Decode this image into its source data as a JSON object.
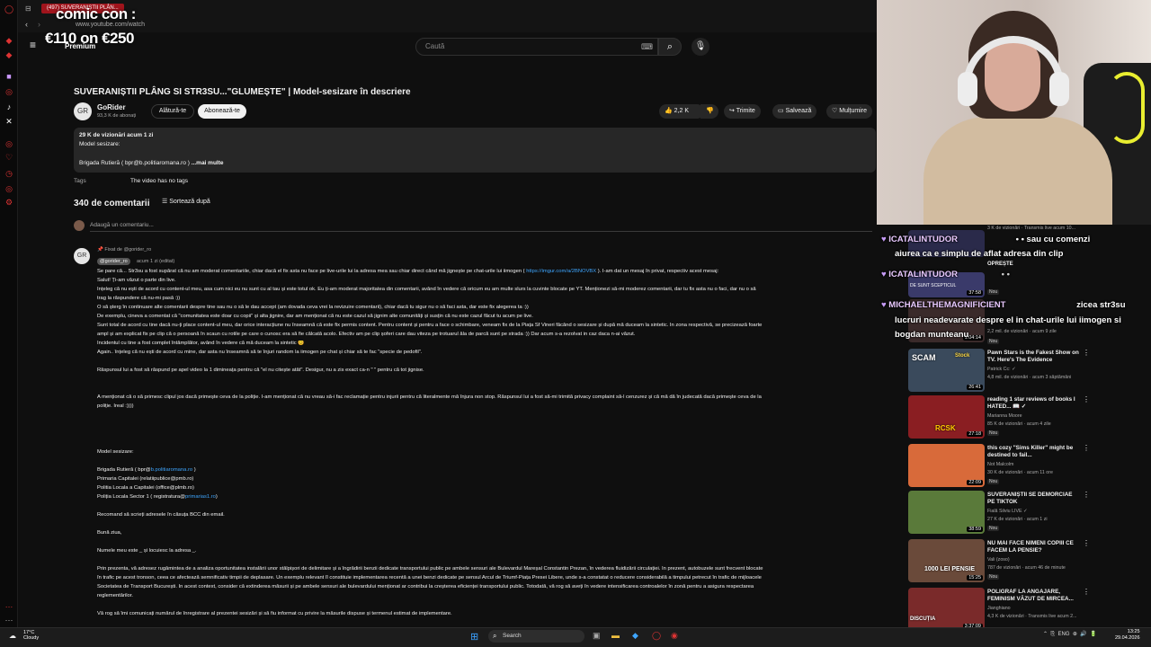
{
  "browser": {
    "tab_title": "(497) SUVERANIȘTII PLÂN...",
    "url": "www.youtube.com/watch"
  },
  "overlay": {
    "line1": "comic con :",
    "line2": "€110 on €250",
    "premium": "Premium"
  },
  "search": {
    "placeholder": "Caută"
  },
  "video": {
    "title": "SUVERANIȘTII PLÂNG SI STR3SU...\"GLUMEȘTE\" | Model-sesizare în descriere",
    "channel": "GoRider",
    "subs": "93,3 K de abonați",
    "join": "Alătură-te",
    "subscribe": "Abonează-te",
    "likes": "2,2 K",
    "share": "Trimite",
    "save": "Salvează",
    "thanks": "Mulțumire"
  },
  "description": {
    "views": "29 K de vizionări  acum 1 zi",
    "line1": "Model sesizare:",
    "line2": "Brigada Rutieră ( bpr@b.politiaromana.ro )",
    "more": "...mai multe",
    "tags_label": "Tags",
    "tags_value": "The video has no tags"
  },
  "comments": {
    "count": "340 de comentarii",
    "sort": "Sortează după",
    "add_placeholder": "Adaugă un comentariu...",
    "pinned": "Fixat de @gorider_ro",
    "author": "@gorider_ro",
    "time": "acum 1 zi (editat)",
    "lines": [
      {
        "t": "Se pare că... Str3su a fost supărat că nu am moderat comentariile, chiar dacă el fix asta nu face pe live-urile lui la adresa mea sau chiar direct când mă jignește pe chat-urile lui iimogen ( ",
        "l": "https://imgur.com/a/2BNOVBX",
        "a": " ). I-am dat un mesaj în privat, respectiv acest mesaj:"
      },
      {
        "t": "Salut! Ți-am văzut o parte din live."
      },
      {
        "t": "Înțeleg că nu ești de acord cu content-ul meu, asa cum nici eu nu sunt cu al tau și este totul ok. Eu ți-am moderat majoritatea din comentarii, având în vedere că oricum eu am multe slurs la cuvinte blocate pe YT. Menționezi să-mi moderez comentarii, dar tu fix asta nu o faci, dar nu o să"
      },
      {
        "t": "trag la răspundere că nu-mi pasă :))"
      },
      {
        "t": "O să șterg în continuare alte comentarii despre tine sau nu o să le dau accept (am dovada ceva vrei la revizuire comentarii), chiar dacă tu sigur nu o să faci asta, dar este fix alegerea ta :))"
      },
      {
        "t": "De exemplu, cineva a comentat că \"comunitatea este doar cu copii\" și alta jignire, dar am menționat că nu este cazul să jignim alte comunități și susțin că nu este cazul făcut tu acum pe live."
      },
      {
        "t": "Sunt total de acord cu tine dacă nu-ți place content-ul meu, dar orice interacțiune nu înseamnă că este fix permis content. Pentru content și pentru a face o schimbare, veneam fix de la Piața Sf Vineri făcând o sesizare și după mă duceam la sintetic. În zona respectivă, se precizează foarte"
      },
      {
        "t": "ampl și am explicat fix pe clip că o persoană în scaun cu rotile pe care o cunosc era să fie călcată acolo. Efectiv am pe clip șoferi care dau viteza pe trotuarul ăla de parcă sunt pe strada :)) Dar acum s-a rezolvat in caz daca n-ai văzut."
      },
      {
        "t": "Incidentul cu tine a fost complet întâmplător, având în vedere că mă duceam la sintetic 😊"
      },
      {
        "t": "Again.. înțeleg că nu ești de acord cu mine, dar asta nu înseamnă să te înjuri random la iimogen pe chat și chiar să te fac \"specie de pedofil\"."
      },
      {
        "t": ""
      },
      {
        "t": "Răspunsul lui a fost să răspund pe apel video la 1 dimineața pentru că \"el nu citește atât\". Desigur, nu a zis exact ca-n \" \" pentru că tot jignise."
      },
      {
        "t": ""
      },
      {
        "t": ""
      },
      {
        "t": "A menționat că o să primesc clipul jos dacă primește ceva de la poliție. I-am menționat că nu vreau să-i fac reclamație pentru injurii pentru că literalmente mă înjura non stop. Răspunsul lui a fost să-mi trimită privacy complaint să-l cenzurez și că mă dă în judecată dacă primește ceva de la"
      },
      {
        "t": "poliție. Ireal :))))"
      }
    ],
    "model_title": "Model sesizare:",
    "model_lines": [
      {
        "t": "Brigada Rutieră ( bpr@",
        "l": "b.politiaromana.ro",
        "a": " )"
      },
      {
        "t": "Primaria Capitalei (relatiipublice@pmb.ro)"
      },
      {
        "t": "Politia Locala a Capitalei (office@plmb.ro)"
      },
      {
        "t": "Poliția Locala Sector 1 ( registratura@",
        "l": "primarias1.ro",
        "a": ")"
      }
    ],
    "bcc": "Recomand să scrieți adresele în căsuța BCC din email.",
    "hello": "Bună ziua,",
    "name_line": "Numele meu este _ și locuiesc la adresa _.",
    "body_lines": [
      "Prin prezenta, vă adresez rugămintea de a analiza oportunitatea instalării unor stâlpișori de delimitare și a îngrădirii benzii dedicate transportului public pe ambele sensuri ale Bulevardul Mareșal Constantin Prezan, în vederea fluidizării circulației. În prezent, autobuzele sunt frecvent blocate",
      "în trafic pe acest tronson, ceea ce afectează semnificativ timpii de deplasare. Un exemplu relevant îl constituie implementarea recentă a unei benzi dedicate pe sensul Arcul de Triumf-Piața Presei Libere, unde s-a constatat o reducere considerabilă a timpului petrecut în trafic de mijloacele",
      "Societatea de Transport București. În acest context, consider că extinderea măsurii și pe ambele sensuri ale bulevardului menționat ar contribui la creșterea eficienței transportului public. Totodată, vă rog să aveți în vedere intensificarea controalelor în zonă pentru a asigura respectarea",
      "reglementărilor."
    ],
    "last_line": "Vă rog să îmi comunicați numărul de înregistrare al prezentei sesizări și să fiu informat cu privire la măsurile dispuse și termenul estimat de implementare."
  },
  "chat": {
    "msg1_user": "ICATALINTUDOR",
    "msg1_text": "• • sau cu comenzi",
    "msg1b": "aiurea ca e simplu de aflat adresa din clip",
    "msg2_user": "ICATALINTUDOR",
    "msg3_user": "MICHAELTHEMAGNIFICIENT",
    "msg3_text": "zicea str3su",
    "msg3b": "lucruri neadevarate despre el in chat-urile lui iimogen si",
    "msg3c": "bogdan munteanu"
  },
  "sidebar": [
    {
      "title": "Pawn Stars is the Fakest Show on TV. Here's The Evidence",
      "channel": "Patrick Cc: ✓",
      "meta": "4,8 mil. de vizionări · acum 3 săptămâni",
      "badge": "",
      "dur": "26:41",
      "color": "#3a4a5c"
    },
    {
      "title": "reading 1 star reviews of books I HATED... 📖 ✓",
      "channel": "Marianna Moore",
      "meta": "85 K de vizionări · acum 4 zile",
      "badge": "Nou",
      "dur": "27:18",
      "color": "#8a1e22"
    },
    {
      "title": "this cozy \"Sims Killer\" might be destined to fail...",
      "channel": "Not Malcolm",
      "meta": "30 K de vizionări · acum 11 ore",
      "badge": "Nou",
      "dur": "22:09",
      "color": "#d86a3a"
    },
    {
      "title": "SUVERANIȘTII SE DEMORCIAE PE TIKTOK",
      "channel": "Fială Silviu LIVE ✓",
      "meta": "27 K de vizionări · acum 1 zi",
      "badge": "Nou",
      "dur": "38:59",
      "color": "#5a7a3a"
    },
    {
      "title": "NU MAI FACE NIMENI COPIII CE FACEM LA PENSIE?",
      "channel": "Vali (zoso)",
      "meta": "787 de vizionări · acum 46 de minute",
      "badge": "Nou",
      "dur": "15:25",
      "color": "#6a4a3a"
    },
    {
      "title": "POLIGRAF LA ANGAJARE, FEMINISM VĂZUT DE MIRCEA...",
      "channel": "Jianghiano",
      "meta": "4,3 K de vizionări · Transmis live acum 2...",
      "badge": "",
      "dur": "3:37:09",
      "color": "#7a2a2a"
    }
  ],
  "sidebar_top": {
    "meta1": "2,2 mil. de vizionări · acum 9 zile",
    "badge1": "Nou",
    "top_meta": "3 K de vizionări · Transmis live acum 10..."
  },
  "sidebar_partial": [
    {
      "dur": "",
      "badge": "Nou"
    },
    {
      "dur": "37:58",
      "badge": "Nou"
    },
    {
      "dur": "1:04:14",
      "badge": "Nou"
    }
  ],
  "overlay_texts": {
    "upper": "OPREȘTE",
    "mid": "DE SUNT SCEPTICUL",
    "thumb2": "TEMA ELEVA FUG..."
  },
  "sidebar_labels": {
    "scam": "SCAM",
    "pensie": "1000 LEI PENSIE",
    "discutia": "DISCUȚIA",
    "stock": "Stock",
    "rcsk": "RCSK"
  },
  "taskbar": {
    "temp": "17°C",
    "weather": "Cloudy",
    "search": "Search",
    "lang": "ENG",
    "time": "13:25",
    "date": "29.04.2026"
  }
}
